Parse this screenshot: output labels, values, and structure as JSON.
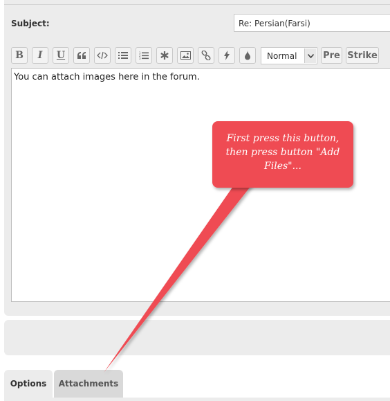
{
  "form": {
    "subject_label": "Subject:",
    "subject_value": "Re: Persian(Farsi)"
  },
  "toolbar": {
    "bold_label": "B",
    "italic_label": "I",
    "underline_label": "U",
    "size_select": "Normal",
    "pre_label": "Pre",
    "strike_label": "Strike",
    "icons": [
      "quote-icon",
      "code-icon",
      "bulleted-list-icon",
      "numbered-list-icon",
      "asterisk-icon",
      "image-icon",
      "link-icon",
      "flash-icon",
      "color-drop-icon"
    ]
  },
  "editor": {
    "body_text": "You can attach images here in the forum."
  },
  "callout": {
    "line1": "First press this button,",
    "line2": "then press button \"Add",
    "line3": "Files\"...",
    "color": "#ef4b52"
  },
  "tabs": {
    "options_label": "Options",
    "attachments_label": "Attachments"
  }
}
